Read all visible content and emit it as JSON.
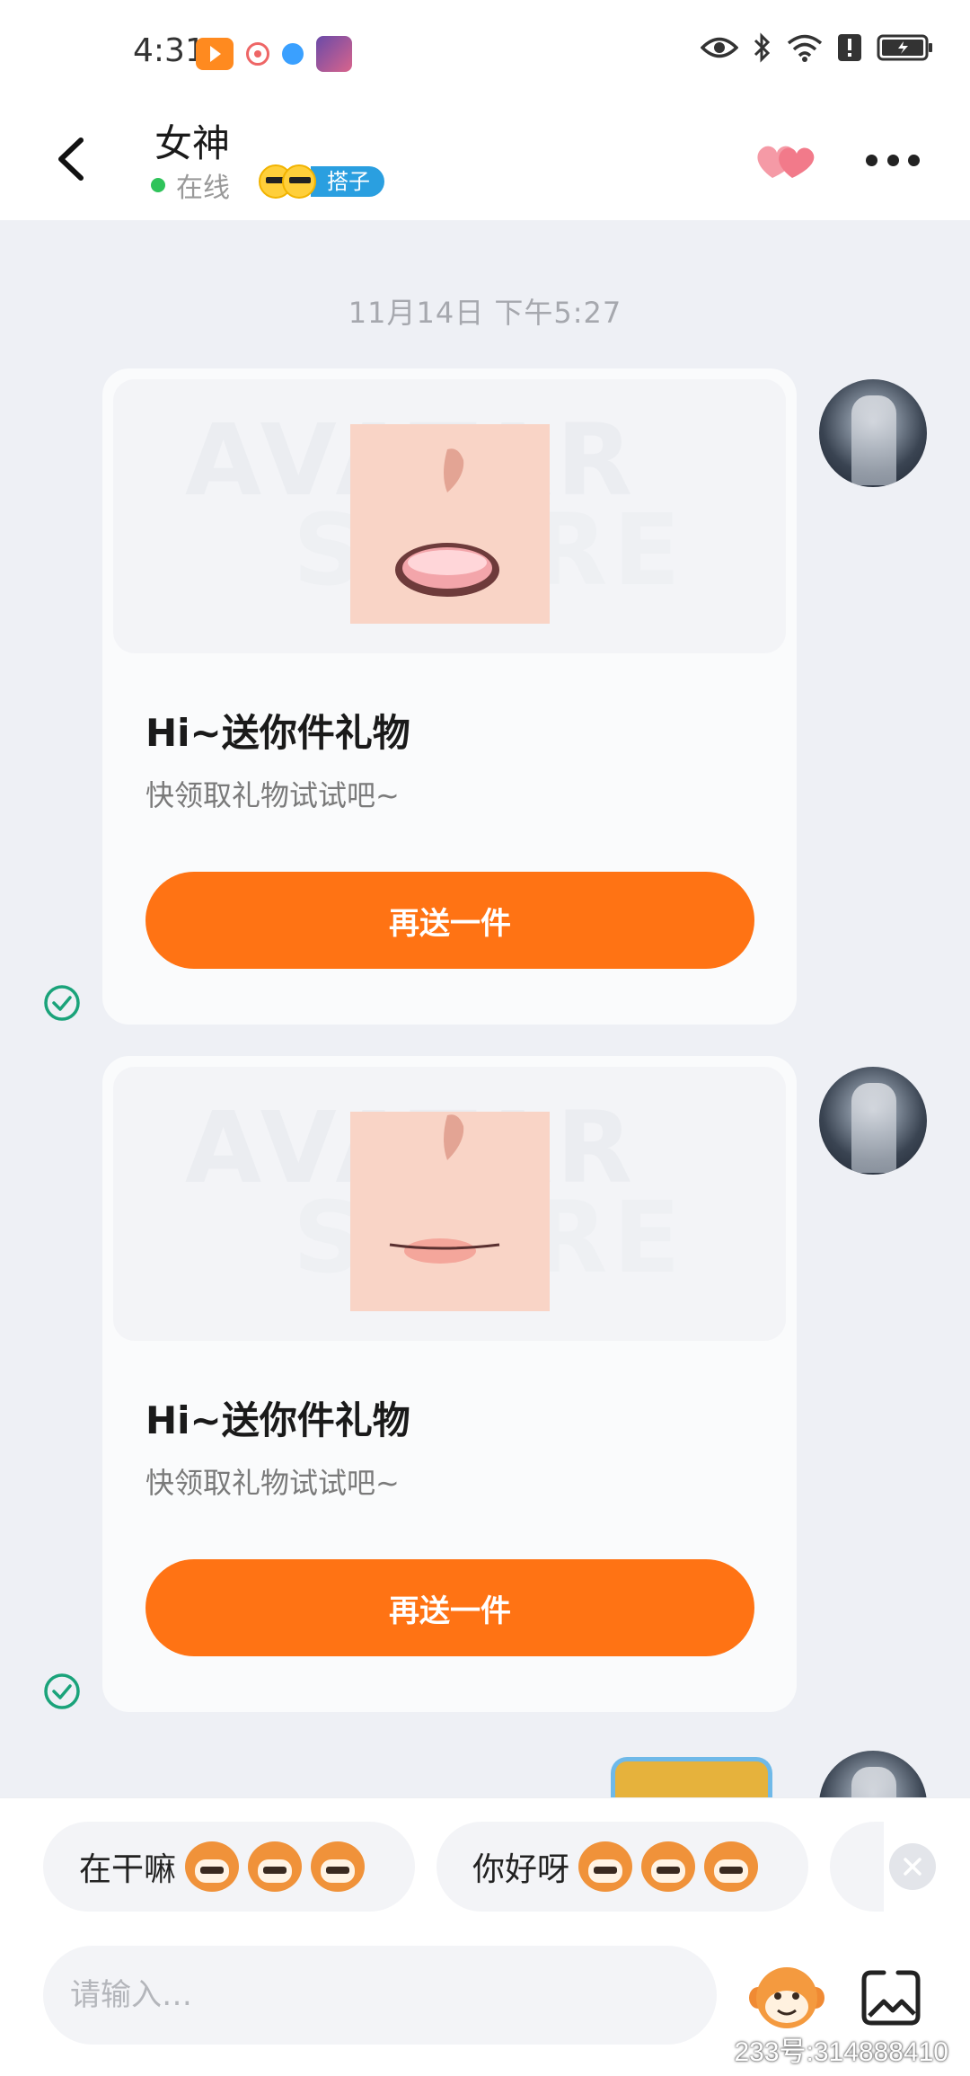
{
  "status_bar": {
    "time": "4:31"
  },
  "header": {
    "contact_name": "女神",
    "presence": "在线",
    "tag": "搭子"
  },
  "chat": {
    "timestamp": "11月14日 下午5:27",
    "messages": [
      {
        "title": "Hi~送你件礼物",
        "subtitle": "快领取礼物试试吧~",
        "button": "再送一件",
        "watermark": [
          "AVATAR",
          "STORE"
        ]
      },
      {
        "title": "Hi~送你件礼物",
        "subtitle": "快领取礼物试试吧~",
        "button": "再送一件",
        "watermark": [
          "AVATAR",
          "STORE"
        ]
      }
    ]
  },
  "bottom": {
    "quick_replies": [
      "在干嘛",
      "你好呀"
    ],
    "input_placeholder": "请输入…",
    "watermark": "233号:314888410"
  },
  "colors": {
    "accent": "#ff7314",
    "online": "#2fc35a",
    "tag": "#2a9fe0",
    "read": "#1aa37a"
  }
}
